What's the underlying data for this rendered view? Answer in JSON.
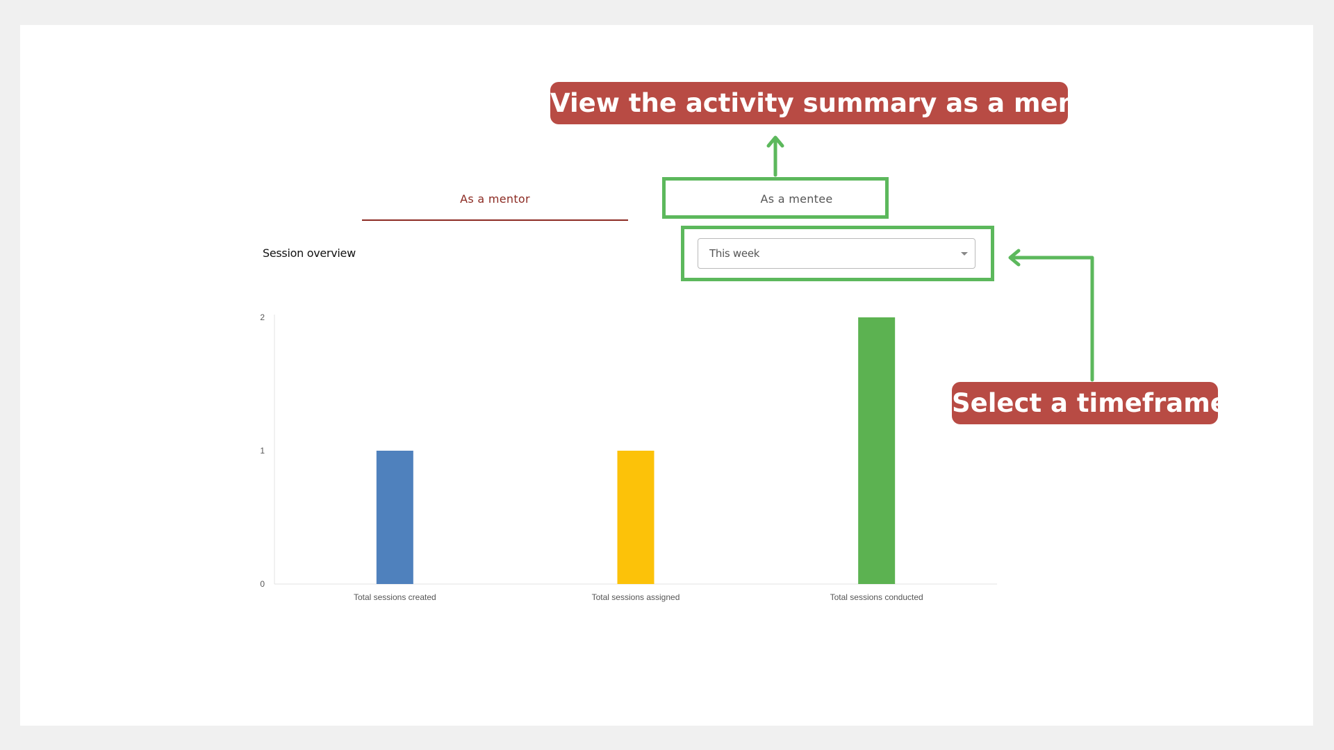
{
  "tabs": [
    {
      "label": "As a mentor",
      "active": true
    },
    {
      "label": "As a mentee",
      "active": false
    }
  ],
  "session_overview": {
    "title": "Session overview"
  },
  "timeframe": {
    "selected": "This week"
  },
  "callouts": {
    "top": "View the activity summary as a mentee.",
    "right": "Select a timeframe."
  },
  "colors": {
    "accent": "#8b2a22",
    "highlight": "#5cb85c",
    "callout": "#b84b44"
  },
  "chart_data": {
    "type": "bar",
    "categories": [
      "Total sessions created",
      "Total sessions assigned",
      "Total sessions conducted"
    ],
    "values": [
      1,
      1,
      2
    ],
    "colors": [
      "#4f81bd",
      "#fcc209",
      "#5cb251"
    ],
    "yticks": [
      0,
      1,
      2
    ],
    "ylim": [
      0,
      2
    ],
    "grid": false,
    "title": "",
    "xlabel": "",
    "ylabel": ""
  }
}
